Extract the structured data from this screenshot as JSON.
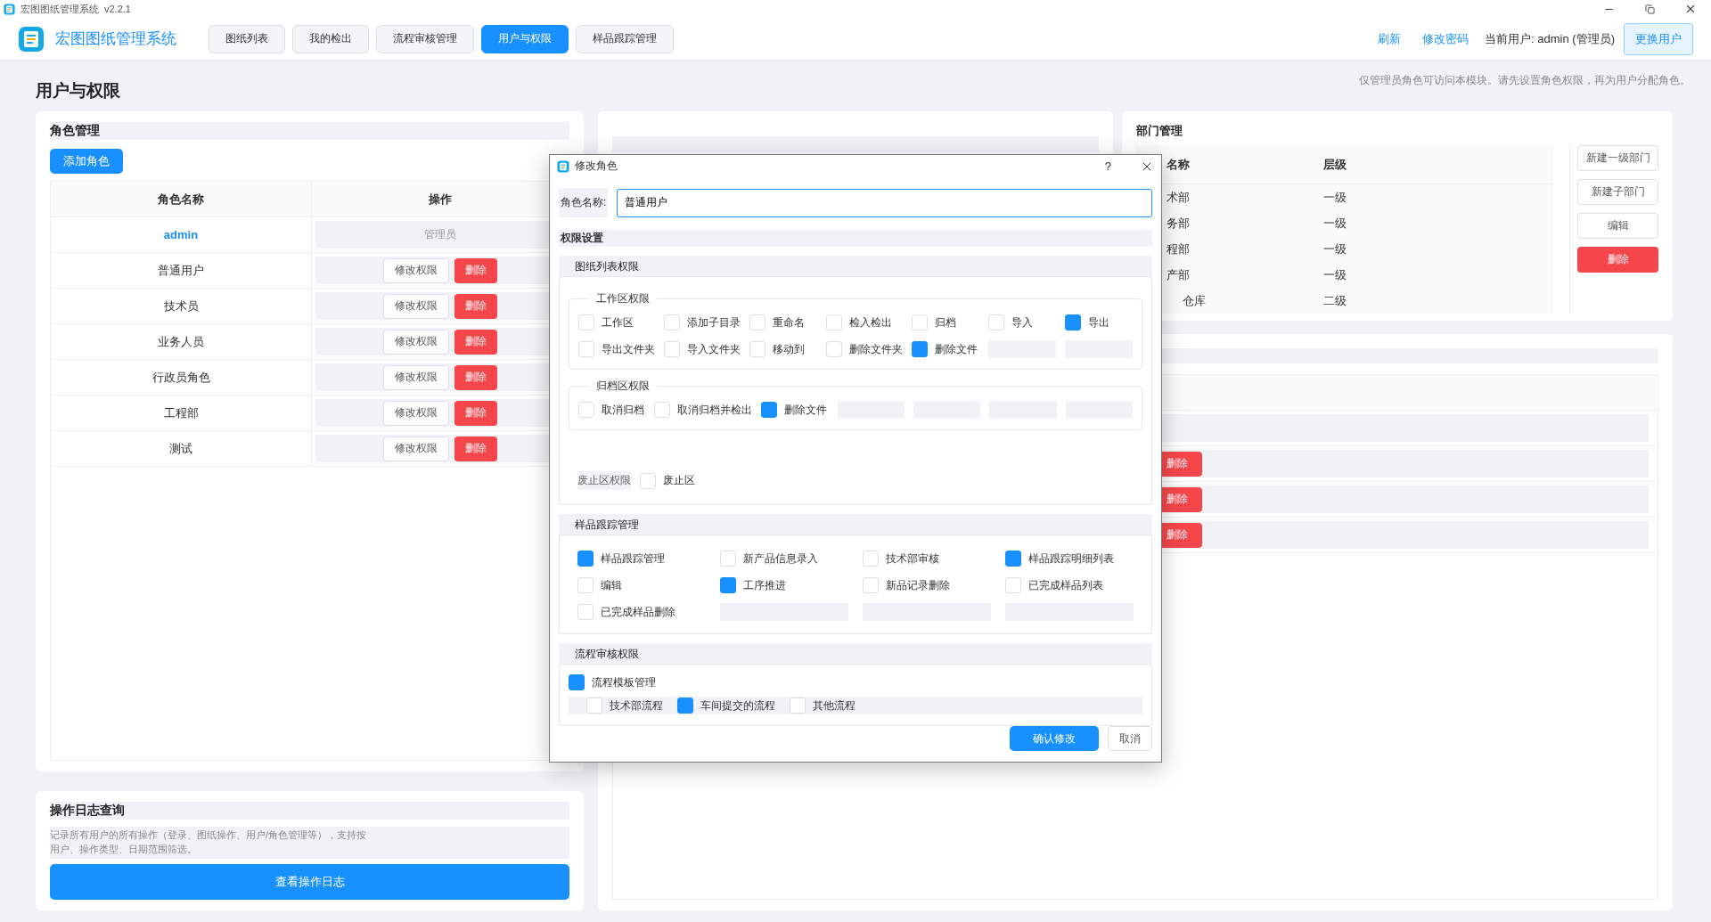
{
  "window": {
    "title": "宏图图纸管理系统",
    "version": "v2.2.1"
  },
  "app": {
    "name": "宏图图纸管理系统"
  },
  "nav_tabs": [
    {
      "label": "图纸列表",
      "selected": false
    },
    {
      "label": "我的检出",
      "selected": false
    },
    {
      "label": "流程审核管理",
      "selected": false
    },
    {
      "label": "用户与权限",
      "selected": true
    },
    {
      "label": "样品跟踪管理",
      "selected": false
    }
  ],
  "header_actions": {
    "refresh": "刷新",
    "change_password": "修改密码",
    "current_user": "当前用户: admin (管理员)",
    "switch_user": "更换用户"
  },
  "page": {
    "title": "用户与权限",
    "hint": "仅管理员角色可访问本模块。请先设置角色权限，再为用户分配角色。"
  },
  "roles_panel": {
    "title": "角色管理",
    "add_button": "添加角色",
    "columns": [
      "角色名称",
      "操作"
    ],
    "rows": [
      {
        "kind": "admin",
        "name": "admin",
        "badge": "管理员"
      },
      {
        "kind": "role",
        "name": "普通用户",
        "edit": "修改权限",
        "delete": "删除"
      },
      {
        "kind": "role",
        "name": "技术员",
        "edit": "修改权限",
        "delete": "删除"
      },
      {
        "kind": "role",
        "name": "业务人员",
        "edit": "修改权限",
        "delete": "删除"
      },
      {
        "kind": "role",
        "name": "行政员角色",
        "edit": "修改权限",
        "delete": "删除"
      },
      {
        "kind": "role",
        "name": "工程部",
        "edit": "修改权限",
        "delete": "删除"
      },
      {
        "kind": "role",
        "name": "测试",
        "edit": "修改权限",
        "delete": "删除"
      }
    ]
  },
  "log_panel": {
    "title": "操作日志查询",
    "description": "记录所有用户的所有操作（登录、图纸操作、用户/角色管理等），支持按用户、操作类型、日期范围筛选。",
    "button": "查看操作日志"
  },
  "departments": {
    "title": "部门管理",
    "columns": [
      "名称",
      "层级"
    ],
    "rows": [
      {
        "name": "术部",
        "tier": "一级"
      },
      {
        "name": "务部",
        "tier": "一级"
      },
      {
        "name": "程部",
        "tier": "一级"
      },
      {
        "name": "产部",
        "tier": "一级",
        "children": [
          {
            "name": "仓库",
            "tier": "二级"
          }
        ]
      }
    ],
    "buttons": [
      {
        "label": "新建一级部门",
        "kind": "default"
      },
      {
        "label": "新建子部门",
        "kind": "default"
      },
      {
        "label": "编辑",
        "kind": "default"
      },
      {
        "label": "删除",
        "kind": "danger"
      }
    ]
  },
  "users_panel": {
    "rows": [
      {
        "delete": "删除"
      },
      {
        "delete": "删除"
      },
      {
        "delete": "删除"
      }
    ]
  },
  "dialog": {
    "title": "修改角色",
    "help": "?",
    "role_label": "角色名称:",
    "role_value": "普通用户",
    "permissions_title": "权限设置",
    "groups": [
      {
        "title": "图纸列表权限",
        "sections": [
          {
            "kind": "fieldset",
            "title": "工作区权限",
            "items": [
              {
                "label": "工作区",
                "checked": false
              },
              {
                "label": "添加子目录",
                "checked": false
              },
              {
                "label": "重命名",
                "checked": false
              },
              {
                "label": "检入检出",
                "checked": false
              },
              {
                "label": "归档",
                "checked": false
              },
              {
                "label": "导入",
                "checked": false
              },
              {
                "label": "导出",
                "checked": true
              },
              {
                "label": "导出文件夹",
                "checked": false
              },
              {
                "label": "导入文件夹",
                "checked": false
              },
              {
                "label": "移动到",
                "checked": false
              },
              {
                "label": "删除文件夹",
                "checked": false
              },
              {
                "label": "删除文件",
                "checked": true
              }
            ]
          },
          {
            "kind": "fieldset",
            "title": "归档区权限",
            "items": [
              {
                "label": "取消归档",
                "checked": false
              },
              {
                "label": "取消归档并检出",
                "checked": false
              },
              {
                "label": "删除文件",
                "checked": true
              }
            ]
          },
          {
            "kind": "inline",
            "title": "废止区权限",
            "items": [
              {
                "label": "废止区",
                "checked": false
              }
            ]
          }
        ]
      },
      {
        "title": "样品跟踪管理",
        "sections": [
          {
            "kind": "grid",
            "items": [
              {
                "label": "样品跟踪管理",
                "checked": true
              },
              {
                "label": "新产品信息录入",
                "checked": false
              },
              {
                "label": "技术部审核",
                "checked": false
              },
              {
                "label": "样品跟踪明细列表",
                "checked": true
              },
              {
                "label": "编辑",
                "checked": false
              },
              {
                "label": "工序推进",
                "checked": true
              },
              {
                "label": "新品记录删除",
                "checked": false
              },
              {
                "label": "已完成样品列表",
                "checked": false
              },
              {
                "label": "已完成样品删除",
                "checked": false
              }
            ]
          }
        ]
      },
      {
        "title": "流程审核权限",
        "sections": [
          {
            "kind": "tree",
            "items": [
              {
                "label": "流程模板管理",
                "checked": true,
                "children": [
                  {
                    "label": "技术部流程",
                    "checked": false
                  },
                  {
                    "label": "车间提交的流程",
                    "checked": true
                  },
                  {
                    "label": "其他流程",
                    "checked": false
                  }
                ]
              }
            ]
          }
        ]
      }
    ],
    "confirm": "确认修改",
    "cancel": "取消"
  }
}
